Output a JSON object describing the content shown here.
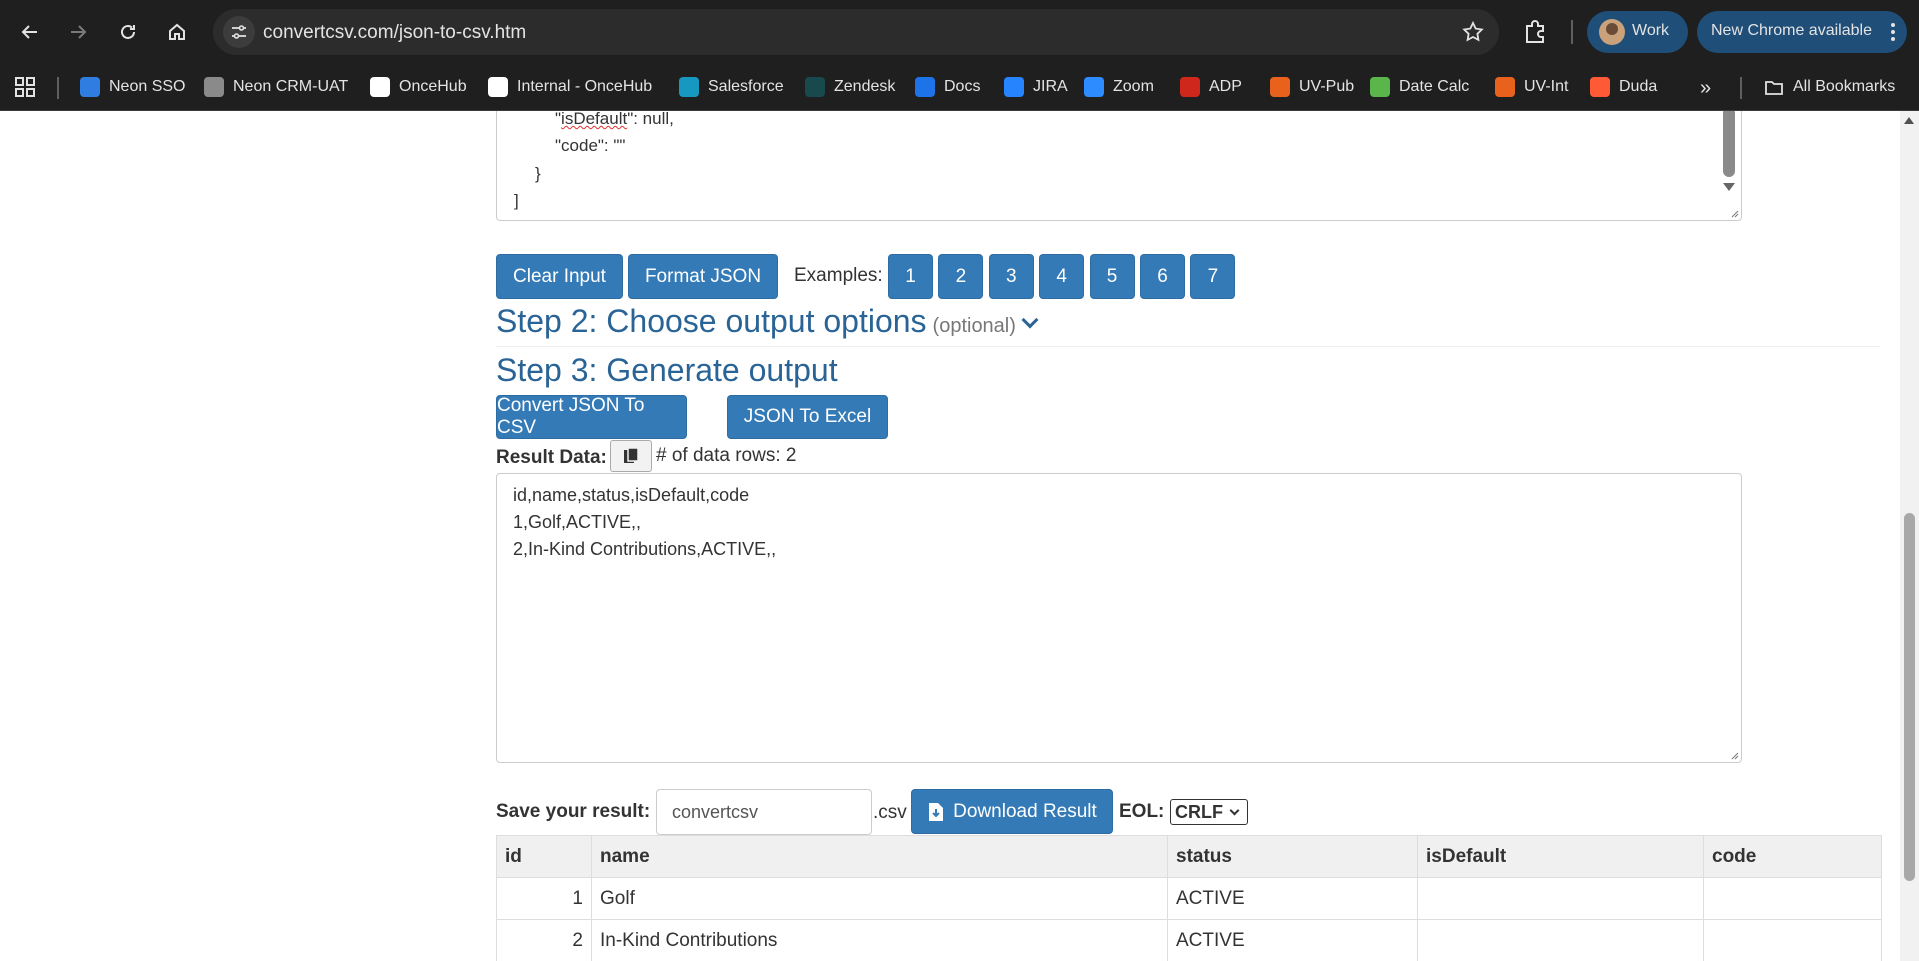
{
  "browser": {
    "url": "convertcsv.com/json-to-csv.htm",
    "profile_label": "Work",
    "update_label": "New Chrome available",
    "bookmarks": [
      {
        "label": "Neon SSO",
        "icon": "neon-icon",
        "color": "#2f7de1"
      },
      {
        "label": "Neon CRM-UAT",
        "icon": "globe-icon",
        "color": "#8a8a8a"
      },
      {
        "label": "OnceHub",
        "icon": "oncehub-icon",
        "color": "#ffffff"
      },
      {
        "label": "Internal - OnceHub",
        "icon": "oncehub-icon",
        "color": "#ffffff"
      },
      {
        "label": "Salesforce",
        "icon": "salesforce-icon",
        "color": "#1798c1"
      },
      {
        "label": "Zendesk",
        "icon": "zendesk-icon",
        "color": "#17494d"
      },
      {
        "label": "Docs",
        "icon": "docs-icon",
        "color": "#1f73e8"
      },
      {
        "label": "JIRA",
        "icon": "jira-icon",
        "color": "#2684ff"
      },
      {
        "label": "Zoom",
        "icon": "zoom-icon",
        "color": "#2d8cff"
      },
      {
        "label": "ADP",
        "icon": "adp-icon",
        "color": "#d0271d"
      },
      {
        "label": "UV-Pub",
        "icon": "uv-icon",
        "color": "#e8621d"
      },
      {
        "label": "Date Calc",
        "icon": "calendar-icon",
        "color": "#5ab54b"
      },
      {
        "label": "UV-Int",
        "icon": "uv-icon",
        "color": "#e8621d"
      },
      {
        "label": "Duda",
        "icon": "duda-icon",
        "color": "#ff5a36"
      }
    ],
    "all_bookmarks_label": "All Bookmarks"
  },
  "input_json": {
    "line1_key": "isDefault",
    "line1_rest": ": null,",
    "line2": "\"code\": \"\"",
    "line3": "}",
    "line4": "]"
  },
  "controls": {
    "clear_input": "Clear Input",
    "format_json": "Format JSON",
    "examples_label": "Examples:",
    "examples": [
      "1",
      "2",
      "3",
      "4",
      "5",
      "6",
      "7"
    ]
  },
  "step2": {
    "title": "Step 2: Choose output options",
    "optional": "(optional)"
  },
  "step3": {
    "title": "Step 3: Generate output",
    "convert_csv": "Convert JSON To CSV",
    "to_excel": "JSON To Excel"
  },
  "result": {
    "label": "Result Data:",
    "rows_text": "# of data rows: 2",
    "lines": [
      "id,name,status,isDefault,code",
      "1,Golf,ACTIVE,,",
      "2,In-Kind Contributions,ACTIVE,,"
    ]
  },
  "save": {
    "label": "Save your result:",
    "filename": "convertcsv",
    "extension": ".csv",
    "download": "Download Result",
    "eol_label": "EOL:",
    "eol_value": "CRLF"
  },
  "table": {
    "headers": [
      "id",
      "name",
      "status",
      "isDefault",
      "code"
    ],
    "rows": [
      [
        "1",
        "Golf",
        "ACTIVE",
        "",
        ""
      ],
      [
        "2",
        "In-Kind Contributions",
        "ACTIVE",
        "",
        ""
      ]
    ]
  }
}
